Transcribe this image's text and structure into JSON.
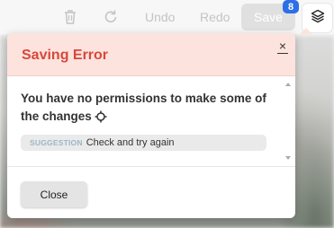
{
  "toolbar": {
    "undo_label": "Undo",
    "redo_label": "Redo",
    "save_label": "Save",
    "save_badge": "8",
    "icons": [
      "trash-icon",
      "redo-arrow-icon",
      "layers-icon"
    ]
  },
  "dialog": {
    "title": "Saving Error",
    "close_symbol": "×",
    "message": "You have no permissions to make some of the changes",
    "suggestion_tag": "SUGGESTION",
    "suggestion_text": "Check and try again",
    "close_button_label": "Close"
  },
  "colors": {
    "error_title": "#d8473b",
    "header_bg": "#fde3dd",
    "badge_bg": "#2d6fe6"
  }
}
